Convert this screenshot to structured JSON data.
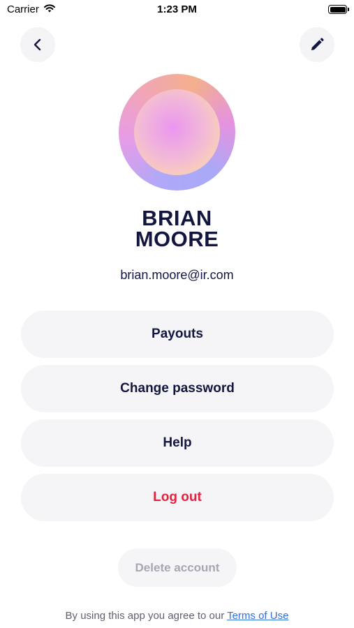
{
  "status_bar": {
    "carrier": "Carrier",
    "time": "1:23 PM",
    "wifi_icon": "wifi-icon",
    "battery_icon": "battery-icon",
    "battery_level": 1.0
  },
  "nav": {
    "back_icon": "chevron-left-icon",
    "edit_icon": "pencil-icon"
  },
  "profile": {
    "first_name": "BRIAN",
    "last_name": "MOORE",
    "email": "brian.moore@ir.com"
  },
  "menu": {
    "payouts": "Payouts",
    "change_password": "Change password",
    "help": "Help",
    "logout": "Log out"
  },
  "delete_account": "Delete account",
  "footer": {
    "prefix": "By using this app you agree to our ",
    "link": "Terms of Use"
  },
  "colors": {
    "primary_text": "#13163f",
    "danger": "#e0243f",
    "link": "#2f6fe0",
    "button_bg": "#f5f5f7"
  }
}
